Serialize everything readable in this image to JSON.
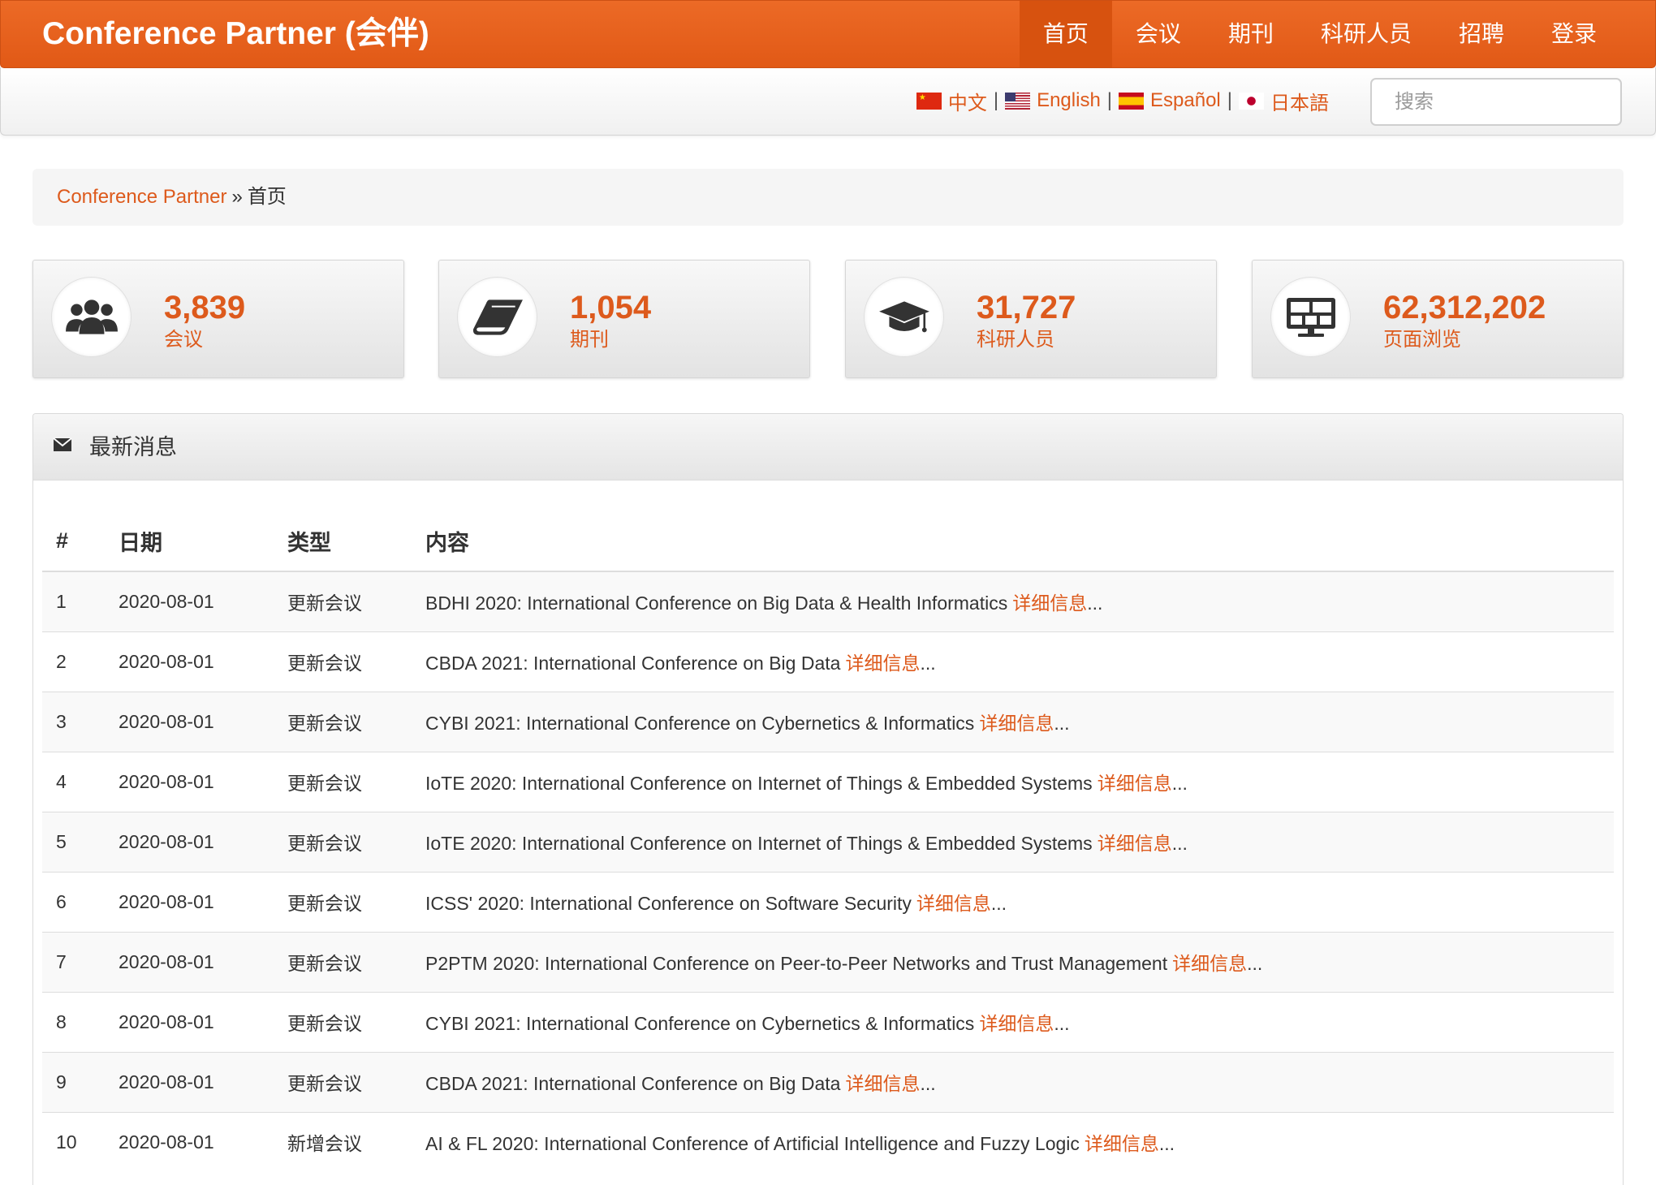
{
  "header": {
    "title": "Conference Partner (会伴)",
    "nav": [
      {
        "label": "首页",
        "active": true
      },
      {
        "label": "会议",
        "active": false
      },
      {
        "label": "期刊",
        "active": false
      },
      {
        "label": "科研人员",
        "active": false
      },
      {
        "label": "招聘",
        "active": false
      },
      {
        "label": "登录",
        "active": false
      }
    ]
  },
  "language_bar": {
    "separator": "|",
    "languages": [
      {
        "label": "中文",
        "flag": "china-flag-icon"
      },
      {
        "label": "English",
        "flag": "us-flag-icon"
      },
      {
        "label": "Español",
        "flag": "spain-flag-icon"
      },
      {
        "label": "日本語",
        "flag": "japan-flag-icon"
      }
    ],
    "search_placeholder": "搜索",
    "search_value": ""
  },
  "breadcrumb": {
    "home": "Conference Partner",
    "separator": "»",
    "current": "首页"
  },
  "stats": [
    {
      "value": "3,839",
      "label": "会议",
      "icon": "users-icon"
    },
    {
      "value": "1,054",
      "label": "期刊",
      "icon": "book-icon"
    },
    {
      "value": "31,727",
      "label": "科研人员",
      "icon": "graduation-cap-icon"
    },
    {
      "value": "62,312,202",
      "label": "页面浏览",
      "icon": "dashboard-monitor-icon"
    }
  ],
  "news": {
    "title": "最新消息",
    "icon": "envelope-icon",
    "columns": [
      "#",
      "日期",
      "类型",
      "内容"
    ],
    "rows": [
      {
        "num": "1",
        "date": "2020-08-01",
        "type": "更新会议",
        "content": "BDHI 2020: International Conference on Big Data & Health Informatics",
        "link": "详细信息",
        "ellipsis": "..."
      },
      {
        "num": "2",
        "date": "2020-08-01",
        "type": "更新会议",
        "content": "CBDA 2021: International Conference on Big Data",
        "link": "详细信息",
        "ellipsis": "..."
      },
      {
        "num": "3",
        "date": "2020-08-01",
        "type": "更新会议",
        "content": "CYBI 2021: International Conference on Cybernetics & Informatics",
        "link": "详细信息",
        "ellipsis": "..."
      },
      {
        "num": "4",
        "date": "2020-08-01",
        "type": "更新会议",
        "content": "IoTE 2020: International Conference on Internet of Things & Embedded Systems",
        "link": "详细信息",
        "ellipsis": "..."
      },
      {
        "num": "5",
        "date": "2020-08-01",
        "type": "更新会议",
        "content": "IoTE 2020: International Conference on Internet of Things & Embedded Systems",
        "link": "详细信息",
        "ellipsis": "..."
      },
      {
        "num": "6",
        "date": "2020-08-01",
        "type": "更新会议",
        "content": "ICSS' 2020: International Conference on Software Security",
        "link": "详细信息",
        "ellipsis": "..."
      },
      {
        "num": "7",
        "date": "2020-08-01",
        "type": "更新会议",
        "content": "P2PTM 2020: International Conference on Peer-to-Peer Networks and Trust Management",
        "link": "详细信息",
        "ellipsis": "..."
      },
      {
        "num": "8",
        "date": "2020-08-01",
        "type": "更新会议",
        "content": "CYBI 2021: International Conference on Cybernetics & Informatics",
        "link": "详细信息",
        "ellipsis": "..."
      },
      {
        "num": "9",
        "date": "2020-08-01",
        "type": "更新会议",
        "content": "CBDA 2021: International Conference on Big Data",
        "link": "详细信息",
        "ellipsis": "..."
      },
      {
        "num": "10",
        "date": "2020-08-01",
        "type": "新增会议",
        "content": "AI & FL 2020: International Conference of Artificial Intelligence and Fuzzy Logic",
        "link": "详细信息",
        "ellipsis": "..."
      }
    ]
  },
  "colors": {
    "header_top": "#ec6a26",
    "header_bg": "#e15916",
    "nav_active_bg": "#d7520f",
    "accent_text": "#dd5a1c",
    "row_stripe": "#f9f9f9"
  }
}
